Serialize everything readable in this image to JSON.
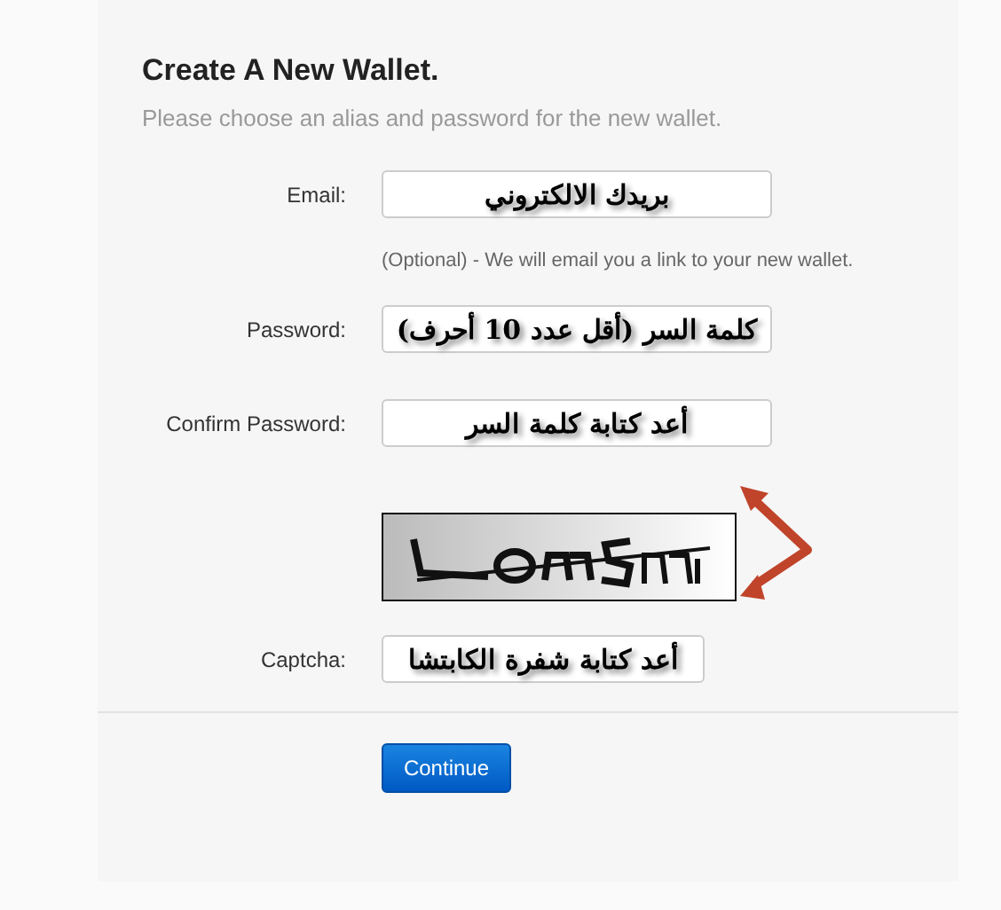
{
  "title": "Create A New Wallet.",
  "subtitle": "Please choose an alias and password for the new wallet.",
  "fields": [
    {
      "kind": "email",
      "label": "Email:",
      "value": "بريدك الالكتروني",
      "hint": "(Optional) - We will email you a link to your new wallet."
    },
    {
      "kind": "password",
      "label": "Password:",
      "value": "كلمة السر (أقل عدد 10 أحرف)"
    },
    {
      "kind": "password",
      "label": "Confirm Password:",
      "value": "أعد كتابة كلمة السر"
    },
    {
      "kind": "captcha",
      "label": "Captcha:",
      "value": "أعد كتابة شفرة الكابتشا"
    }
  ],
  "buttons": [
    "Continue"
  ]
}
